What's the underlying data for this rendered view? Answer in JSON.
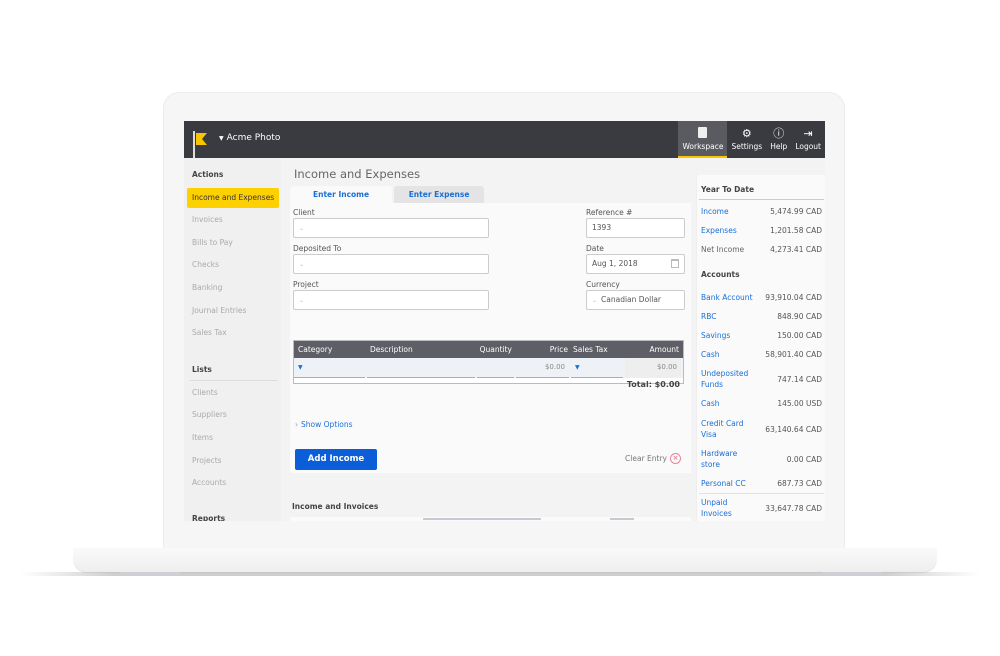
{
  "app": {
    "company_name": "Acme Photo",
    "nav": [
      {
        "label": "Workspace",
        "icon": "document-icon",
        "active": true
      },
      {
        "label": "Settings",
        "icon": "gear-icon"
      },
      {
        "label": "Help",
        "icon": "help-icon"
      },
      {
        "label": "Logout",
        "icon": "logout-icon"
      }
    ],
    "accent_color": "#fdd000",
    "link_color": "#1a6fd6"
  },
  "sidebar": {
    "actions_heading": "Actions",
    "actions": [
      {
        "label": "Income and Expenses",
        "active": true
      },
      {
        "label": "Invoices"
      },
      {
        "label": "Bills to Pay"
      },
      {
        "label": "Checks"
      },
      {
        "label": "Banking"
      },
      {
        "label": "Journal Entries"
      },
      {
        "label": "Sales Tax"
      }
    ],
    "lists_heading": "Lists",
    "lists": [
      {
        "label": "Clients"
      },
      {
        "label": "Suppliers"
      },
      {
        "label": "Items"
      },
      {
        "label": "Projects"
      },
      {
        "label": "Accounts"
      }
    ],
    "reports_heading": "Reports"
  },
  "main": {
    "title": "Income and Expenses",
    "tabs": [
      {
        "label": "Enter Income",
        "active": true
      },
      {
        "label": "Enter Expense"
      }
    ],
    "form": {
      "client_label": "Client",
      "client_value": "",
      "deposited_to_label": "Deposited To",
      "deposited_to_value": "",
      "project_label": "Project",
      "project_value": "",
      "reference_label": "Reference #",
      "reference_value": "1393",
      "date_label": "Date",
      "date_value": "Aug 1, 2018",
      "currency_label": "Currency",
      "currency_value": "Canadian Dollar"
    },
    "grid": {
      "columns": [
        "Category",
        "Description",
        "Quantity",
        "Price",
        "Sales Tax",
        "Amount"
      ],
      "rows": [
        {
          "category": "",
          "description": "",
          "quantity": "",
          "price": "$0.00",
          "sales_tax": "",
          "amount": "$0.00"
        }
      ],
      "total": "Total: $0.00"
    },
    "show_options": "Show Options",
    "add_button": "Add Income",
    "clear_entry": "Clear Entry",
    "income_invoices_heading": "Income and Invoices"
  },
  "right_panel": {
    "ytd_heading": "Year To Date",
    "ytd": [
      {
        "label": "Income",
        "value": "5,474.99 CAD",
        "link": true
      },
      {
        "label": "Expenses",
        "value": "1,201.58 CAD",
        "link": true
      },
      {
        "label": "Net Income",
        "value": "4,273.41 CAD",
        "link": false
      }
    ],
    "accounts_heading": "Accounts",
    "accounts": [
      {
        "label": "Bank Account",
        "value": "93,910.04 CAD"
      },
      {
        "label": "RBC",
        "value": "848.90 CAD"
      },
      {
        "label": "Savings",
        "value": "150.00 CAD"
      },
      {
        "label": "Cash",
        "value": "58,901.40 CAD"
      },
      {
        "label": "Undeposited Funds",
        "value": "747.14 CAD"
      },
      {
        "label": "Cash",
        "value": "145.00 USD"
      },
      {
        "label": "Credit Card Visa",
        "value": "63,140.64 CAD"
      },
      {
        "label": "Hardware store",
        "value": "0.00 CAD"
      },
      {
        "label": "Personal CC",
        "value": "687.73 CAD"
      },
      {
        "label": "Unpaid Invoices",
        "value": "33,647.78 CAD"
      }
    ]
  }
}
